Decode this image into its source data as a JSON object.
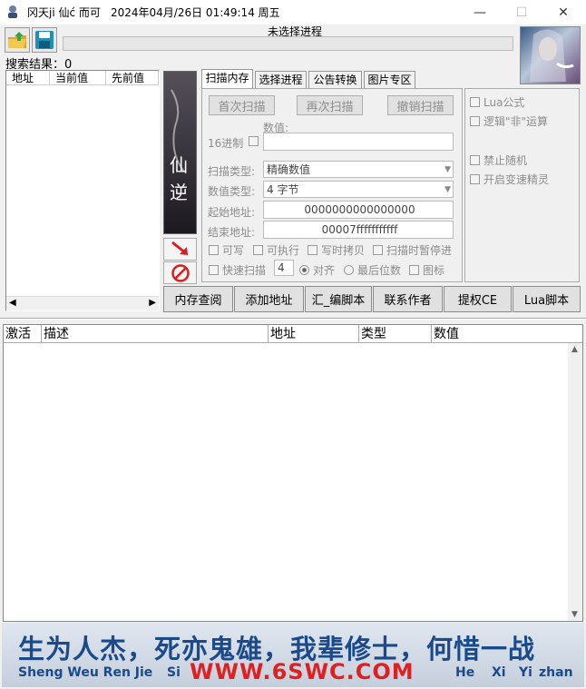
{
  "window": {
    "title": "冈天ji 仙ć 而可",
    "datetime": "2024年04月/26日 01:49:14 周五",
    "min_glyph": "—",
    "max_glyph": "☐",
    "close_glyph": "✕"
  },
  "status": {
    "process": "未选择进程"
  },
  "results": {
    "label": "搜索结果：",
    "count": "0",
    "columns": [
      "地址",
      "当前值",
      "先前值"
    ]
  },
  "tabs": [
    "扫描内存",
    "选择进程",
    "公告转换",
    "图片专区"
  ],
  "scan": {
    "first_scan": "首次扫描",
    "next_scan": "再次扫描",
    "undo_scan": "撤销扫描",
    "value_label": "数值:",
    "hex_label": "16进制",
    "scan_type_label": "扫描类型:",
    "scan_type": "精确数值",
    "value_type_label": "数值类型:",
    "value_type": "4 字节",
    "start_label": "起始地址:",
    "start_addr": "0000000000000000",
    "end_label": "结束地址:",
    "end_addr": "00007fffffffffff",
    "writable": "可写",
    "executable": "可执行",
    "copy_on_write": "写时拷贝",
    "pause_scan": "扫描时暂停进",
    "fast_scan": "快速扫描",
    "fast_value": "4",
    "align": "对齐",
    "last_digits": "最后位数",
    "icon": "图标"
  },
  "options": {
    "lua_formula": "Lua公式",
    "logic_not": "逻辑\"非\"运算",
    "disable_random": "禁止随机",
    "speedhack": "开启变速精灵"
  },
  "actions": [
    "内存查阅",
    "添加地址",
    "汇_编脚本",
    "联系作者",
    "提权CE",
    "Lua脚本"
  ],
  "table": {
    "columns": [
      "激活",
      "描述",
      "地址",
      "类型",
      "数值"
    ]
  },
  "banner": {
    "main": "生为人杰，死亦鬼雄，我辈修士，何惜一战",
    "pinyin_left": "Sheng Weu Ren Jie",
    "pinyin_si": "Si",
    "pinyin_right": [
      "He",
      "Xi",
      "Yi",
      "zhan"
    ],
    "watermark": "WWW.6SWC.COM"
  },
  "colors": {
    "banner_text": "#1b4a8a",
    "watermark": "#e02020",
    "arrow": "#d62020"
  }
}
